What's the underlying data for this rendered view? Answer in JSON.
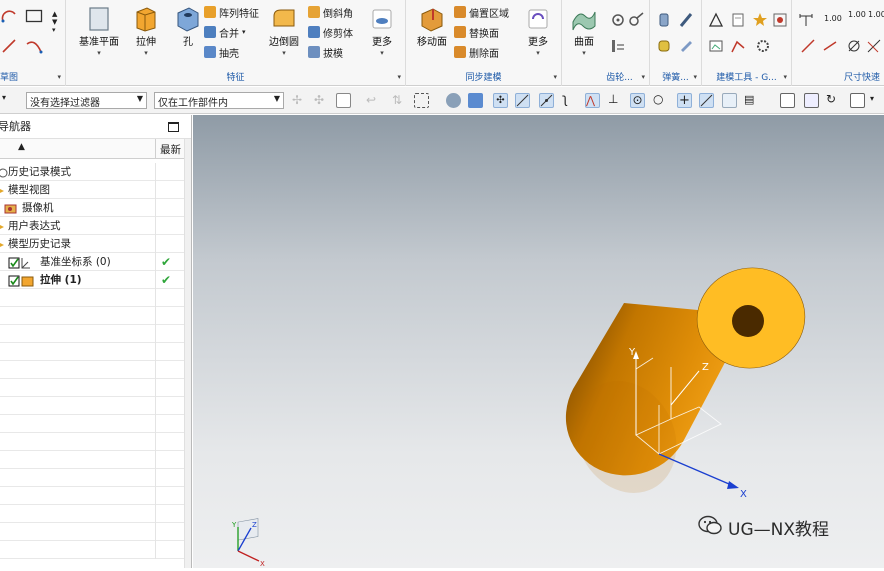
{
  "ribbon": {
    "groups": [
      {
        "label": "草图"
      },
      {
        "label": "特征"
      },
      {
        "label": "同步建模"
      },
      {
        "label": "齿轮..."
      },
      {
        "label": "弹簧..."
      },
      {
        "label": "建模工具 - G..."
      },
      {
        "label": "尺寸快速"
      }
    ],
    "feature_buttons": {
      "datum_plane": "基准平面",
      "extrude": "拉伸",
      "hole": "孔",
      "pattern_feature": "阵列特征",
      "unite": "合并",
      "shell": "抽壳",
      "edge_blend": "边倒圆",
      "chamfer": "倒斜角",
      "trim_body": "修剪体",
      "draft": "拔模",
      "more": "更多"
    },
    "sync_buttons": {
      "move_face": "移动面",
      "offset_region": "偏置区域",
      "replace_face": "替换面",
      "delete_face": "删除面",
      "more": "更多"
    },
    "surface_buttons": {
      "surface": "曲面"
    },
    "dimension_labels": [
      "1.00",
      "1.00",
      "1.00"
    ]
  },
  "toolbar": {
    "filter_combo": "没有选择过滤器",
    "scope_combo": "仅在工作部件内"
  },
  "navigator": {
    "title": "导航器",
    "col_latest": "最新",
    "rows": [
      {
        "label": "历史记录模式",
        "bold": false,
        "check": ""
      },
      {
        "label": "模型视图",
        "bold": false,
        "check": ""
      },
      {
        "label": "摄像机",
        "bold": false,
        "check": ""
      },
      {
        "label": "用户表达式",
        "bold": false,
        "check": ""
      },
      {
        "label": "模型历史记录",
        "bold": false,
        "check": ""
      },
      {
        "label": "基准坐标系 (0)",
        "bold": false,
        "check": "✔"
      },
      {
        "label": "拉伸 (1)",
        "bold": true,
        "check": "✔"
      }
    ]
  },
  "viewport": {
    "axis_labels": {
      "x": "X",
      "y": "Y",
      "z": "Z"
    },
    "body_color": "#f29a07",
    "background_top": "#8f9ba6",
    "background_bottom": "#eeeff0"
  },
  "watermark": {
    "text": "UG—NX教程"
  }
}
